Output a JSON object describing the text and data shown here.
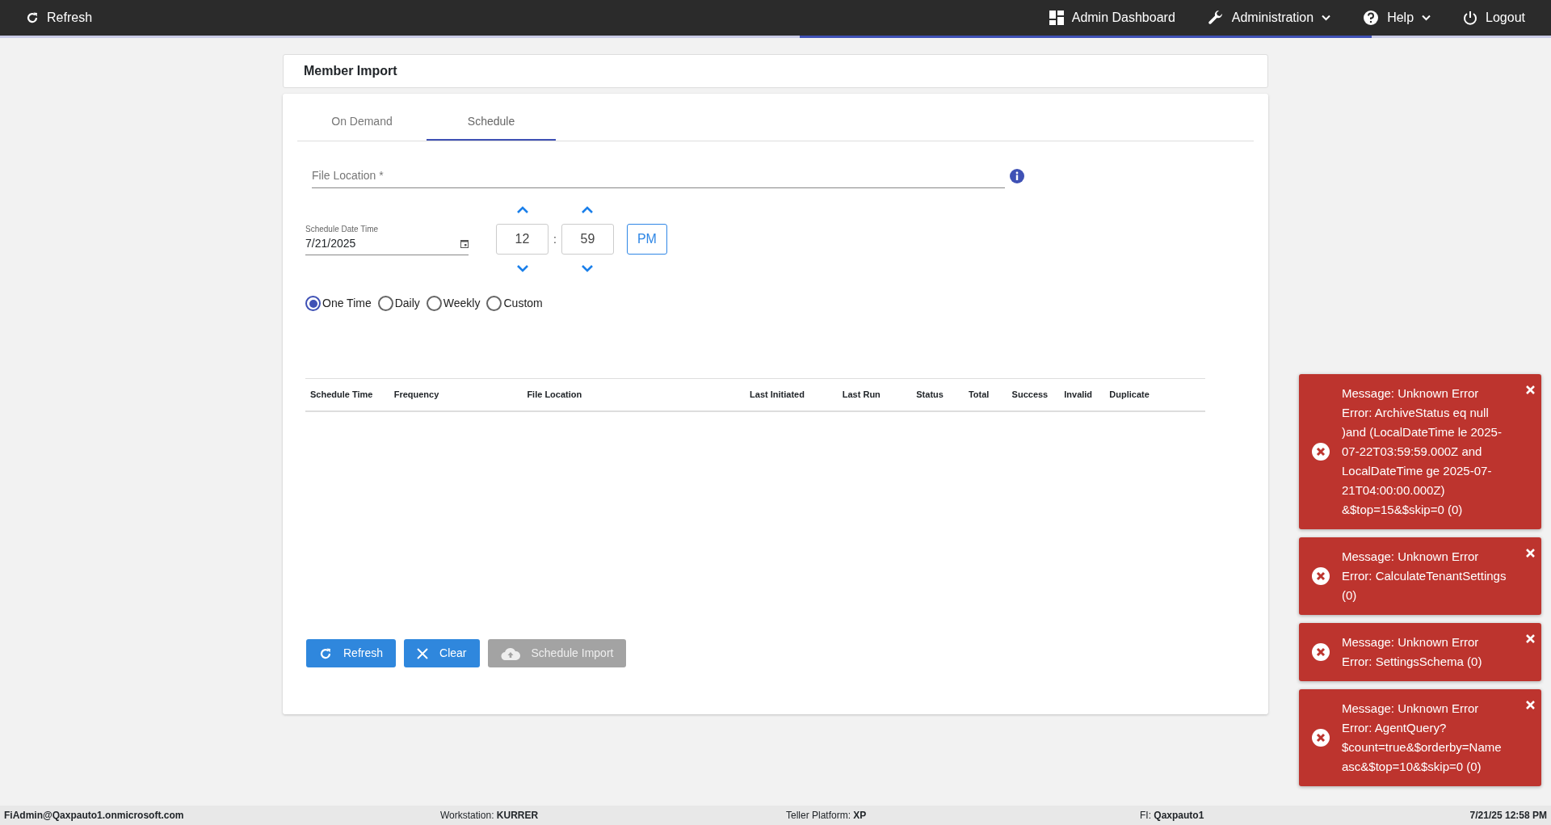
{
  "topbar": {
    "refresh": "Refresh",
    "menu": [
      {
        "kind": "dashboard",
        "label": "Admin Dashboard",
        "dropdown": false
      },
      {
        "kind": "wrench",
        "label": "Administration",
        "dropdown": true
      },
      {
        "kind": "help",
        "label": "Help",
        "dropdown": true
      },
      {
        "kind": "power",
        "label": "Logout",
        "dropdown": false
      }
    ]
  },
  "page_title": "Member Import",
  "tabs": [
    {
      "label": "On Demand",
      "selected": false
    },
    {
      "label": "Schedule",
      "selected": true
    }
  ],
  "file_location": {
    "placeholder": "File Location *"
  },
  "schedule_date": {
    "label": "Schedule Date Time",
    "value": "7/21/2025"
  },
  "time": {
    "hour": "12",
    "separator": ":",
    "minute": "59",
    "meridiem": "PM"
  },
  "frequency": [
    {
      "label": "One Time",
      "selected": true
    },
    {
      "label": "Daily",
      "selected": false
    },
    {
      "label": "Weekly",
      "selected": false
    },
    {
      "label": "Custom",
      "selected": false
    }
  ],
  "table": {
    "columns": [
      "Schedule Time",
      "Frequency",
      "File Location",
      "Last Initiated",
      "Last Run",
      "Status",
      "Total",
      "Success",
      "Invalid",
      "Duplicate"
    ]
  },
  "buttons": [
    {
      "kind": "refresh",
      "label": "Refresh",
      "disabled": false
    },
    {
      "kind": "clear",
      "label": "Clear",
      "disabled": false
    },
    {
      "kind": "upload",
      "label": "Schedule Import",
      "disabled": true
    }
  ],
  "toasts": [
    {
      "message": "Message: Unknown Error",
      "error": "Error: ArchiveStatus eq null )and (LocalDateTime le 2025-07-22T03:59:59.000Z and LocalDateTime ge 2025-07-21T04:00:00.000Z) &$top=15&$skip=0 (0)"
    },
    {
      "message": "Message: Unknown Error",
      "error": "Error: CalculateTenantSettings (0)"
    },
    {
      "message": "Message: Unknown Error",
      "error": "Error: SettingsSchema (0)"
    },
    {
      "message": "Message: Unknown Error",
      "error": "Error: AgentQuery? $count=true&$orderby=Name asc&$top=10&$skip=0 (0)"
    }
  ],
  "status_bar": {
    "user": "FiAdmin@Qaxpauto1.onmicrosoft.com",
    "workstation": "Workstation: **KURRER**",
    "platform": "Teller Platform: **XP**",
    "fi": "FI: **Qaxpauto1**",
    "datetime": "7/21/25 12:58 PM"
  }
}
